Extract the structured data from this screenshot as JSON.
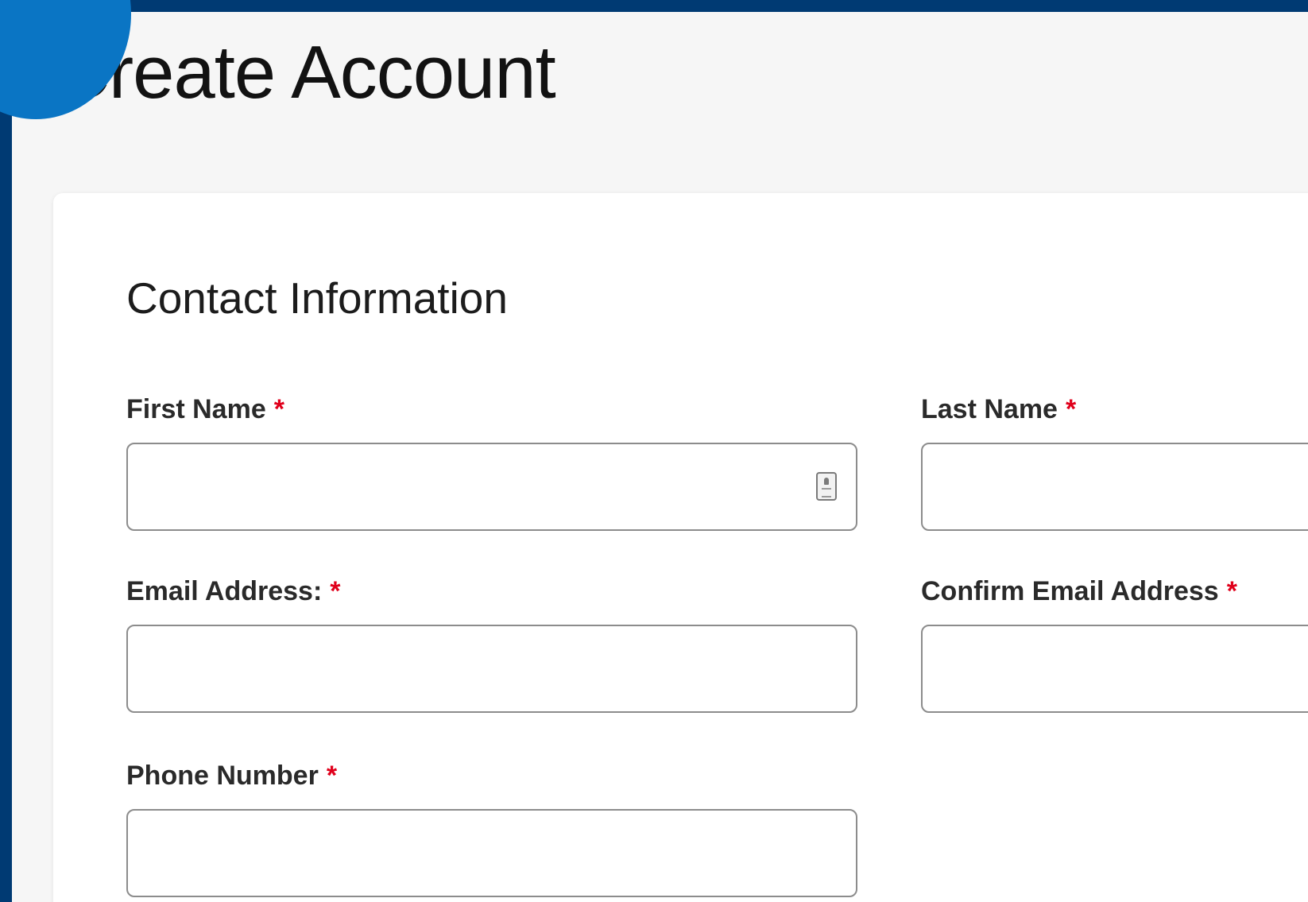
{
  "page": {
    "title": "Create Account"
  },
  "form": {
    "section_title": "Contact Information",
    "required_marker": "*",
    "fields": {
      "first_name": {
        "label": "First Name",
        "value": "",
        "icon": "contact-card-icon"
      },
      "last_name": {
        "label": "Last Name",
        "value": ""
      },
      "email": {
        "label": "Email Address:",
        "value": ""
      },
      "confirm_email": {
        "label": "Confirm Email Address",
        "value": ""
      },
      "phone": {
        "label": "Phone Number",
        "value": ""
      }
    }
  },
  "colors": {
    "frame": "#003a73",
    "accent_circle": "#0a75c4",
    "page_background": "#f6f6f6",
    "card_background": "#ffffff",
    "required": "#e0001b",
    "input_border": "#8c8c8c"
  }
}
